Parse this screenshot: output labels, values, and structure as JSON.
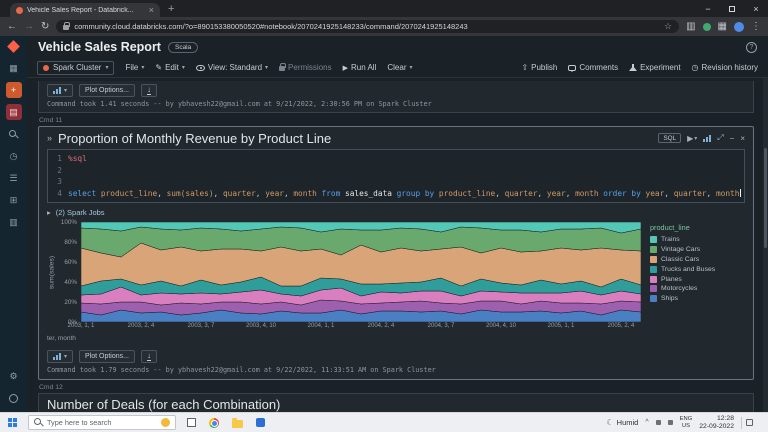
{
  "browser": {
    "tab_title": "Vehicle Sales Report - Databrick...",
    "url": "community.cloud.databricks.com/?o=890153380050520#notebook/2070241925148233/command/2070241925148243"
  },
  "header": {
    "title": "Vehicle Sales Report",
    "badge": "Scala"
  },
  "toolbar": {
    "cluster_label": "Spark Cluster",
    "file_label": "File",
    "edit_label": "Edit",
    "view_label": "View: Standard",
    "permissions_label": "Permissions",
    "run_all_label": "Run All",
    "clear_label": "Clear",
    "publish_label": "Publish",
    "comments_label": "Comments",
    "experiment_label": "Experiment",
    "revision_label": "Revision history"
  },
  "prev_cell": {
    "plot_options_label": "Plot Options...",
    "footer": "Command took 1.41 seconds -- by ybhavesh22@gmail.com at 9/21/2022, 2:30:56 PM on Spark Cluster"
  },
  "cmd11": {
    "label": "Cmd 11",
    "title": "Proportion of Monthly Revenue by Product Line",
    "badge": "SQL",
    "code": {
      "line_numbers": [
        "1",
        "2",
        "3",
        "4"
      ],
      "lines": [
        {
          "tokens": [
            {
              "text": "%sql",
              "type": "magic"
            }
          ]
        },
        {
          "tokens": []
        },
        {
          "tokens": []
        },
        {
          "tokens": [
            {
              "text": "select ",
              "type": "kw"
            },
            {
              "text": "product_line",
              "type": "col"
            },
            {
              "text": ", ",
              "type": "pun"
            },
            {
              "text": "sum(sales)",
              "type": "col"
            },
            {
              "text": ", ",
              "type": "pun"
            },
            {
              "text": "quarter",
              "type": "col"
            },
            {
              "text": ", ",
              "type": "pun"
            },
            {
              "text": "year",
              "type": "col"
            },
            {
              "text": ", ",
              "type": "pun"
            },
            {
              "text": "month",
              "type": "col"
            },
            {
              "text": " from ",
              "type": "kw"
            },
            {
              "text": "sales_data",
              "type": "tbl"
            },
            {
              "text": " group by ",
              "type": "kw"
            },
            {
              "text": "product_line",
              "type": "col"
            },
            {
              "text": ", ",
              "type": "pun"
            },
            {
              "text": "quarter",
              "type": "col"
            },
            {
              "text": ", ",
              "type": "pun"
            },
            {
              "text": "year",
              "type": "col"
            },
            {
              "text": ", ",
              "type": "pun"
            },
            {
              "text": "month",
              "type": "col"
            },
            {
              "text": " order by ",
              "type": "kw"
            },
            {
              "text": "year",
              "type": "col"
            },
            {
              "text": ", ",
              "type": "pun"
            },
            {
              "text": "quarter",
              "type": "col"
            },
            {
              "text": ", ",
              "type": "pun"
            },
            {
              "text": "month",
              "type": "col"
            }
          ]
        }
      ]
    },
    "spark_jobs_label": "(2) Spark Jobs",
    "plot_options_label": "Plot Options...",
    "footer": "Command took 1.79 seconds -- by ybhavesh22@gmail.com at 9/22/2022, 11:33:51 AM on Spark Cluster"
  },
  "cmd12": {
    "label": "Cmd 12",
    "title": "Number of Deals (for each Combination)"
  },
  "chart_data": {
    "type": "area",
    "stacked": "percent",
    "title": "Proportion of Monthly Revenue by Product Line",
    "ylabel": "sum(sales)",
    "xlabel": "ter, month",
    "legend_title": "product_line",
    "legend_position": "right",
    "grid": true,
    "ylim": [
      0,
      100
    ],
    "y_tick_labels": [
      "0%",
      "20%",
      "40%",
      "60%",
      "80%",
      "100%"
    ],
    "x_count": 29,
    "x_tick_indices": [
      0,
      3,
      6,
      9,
      12,
      15,
      18,
      21,
      24,
      27
    ],
    "x_tick_labels": [
      "2003, 1, 1",
      "2003, 2, 4",
      "2003, 3, 7",
      "2003, 4, 10",
      "2004, 1, 1",
      "2004, 2, 4",
      "2004, 3, 7",
      "2004, 4, 10",
      "2005, 1, 1",
      "2005, 2, 4"
    ],
    "series": [
      {
        "name": "Trains",
        "color": "#53c8b6",
        "values": [
          6,
          7,
          9,
          5,
          7,
          8,
          6,
          7,
          9,
          7,
          5,
          6,
          10,
          7,
          8,
          8,
          6,
          7,
          10,
          5,
          6,
          8,
          8,
          10,
          7,
          7,
          6,
          11,
          7
        ]
      },
      {
        "name": "Vintage Cars",
        "color": "#69a96e",
        "values": [
          20,
          24,
          26,
          16,
          21,
          17,
          23,
          20,
          18,
          22,
          20,
          23,
          17,
          26,
          15,
          22,
          20,
          22,
          17,
          20,
          25,
          18,
          22,
          19,
          19,
          21,
          20,
          17,
          22
        ]
      },
      {
        "name": "Classic Cars",
        "color": "#d8a478",
        "values": [
          38,
          28,
          22,
          42,
          31,
          39,
          29,
          36,
          33,
          26,
          39,
          35,
          29,
          24,
          39,
          32,
          35,
          31,
          29,
          39,
          26,
          35,
          33,
          29,
          36,
          31,
          39,
          29,
          34
        ]
      },
      {
        "name": "Trucks and Buses",
        "color": "#2f9e9b",
        "values": [
          9,
          13,
          8,
          10,
          12,
          8,
          13,
          9,
          10,
          13,
          8,
          10,
          12,
          9,
          12,
          8,
          10,
          9,
          13,
          10,
          12,
          9,
          8,
          13,
          9,
          10,
          8,
          12,
          9
        ]
      },
      {
        "name": "Planes",
        "color": "#d97fc0",
        "values": [
          8,
          10,
          15,
          7,
          12,
          9,
          11,
          8,
          10,
          14,
          8,
          9,
          10,
          13,
          8,
          11,
          9,
          10,
          12,
          8,
          10,
          9,
          11,
          8,
          10,
          12,
          9,
          10,
          8
        ]
      },
      {
        "name": "Motorcycles",
        "color": "#9d5fae",
        "values": [
          9,
          11,
          8,
          11,
          7,
          12,
          9,
          8,
          11,
          10,
          9,
          8,
          13,
          9,
          10,
          8,
          9,
          11,
          8,
          10,
          9,
          11,
          8,
          10,
          10,
          8,
          11,
          9,
          10
        ]
      },
      {
        "name": "Ships",
        "color": "#4b7fc4",
        "values": [
          10,
          7,
          12,
          9,
          10,
          7,
          9,
          12,
          9,
          8,
          11,
          9,
          9,
          12,
          8,
          11,
          11,
          10,
          11,
          8,
          12,
          10,
          10,
          11,
          9,
          11,
          7,
          12,
          10
        ]
      }
    ]
  },
  "taskbar": {
    "search_placeholder": "Type here to search",
    "weather_label": "Humid",
    "language_line1": "ENG",
    "language_line2": "US",
    "time": "12:28",
    "date": "22-09-2022"
  },
  "icons": {
    "close": "×",
    "minimize": "−",
    "plus": "+",
    "back": "←",
    "forward": "→",
    "reload": "↻",
    "star": "☆",
    "menu_dots": "⋮",
    "panel": "▥",
    "grid": "▦",
    "doc": "▤",
    "list": "☰",
    "gear": "⚙",
    "clock": "◷",
    "question": "?",
    "collapse": "»",
    "caret_down": "▾",
    "play": "▶",
    "expand": "⤢",
    "pencil": "✎",
    "upload": "⇧",
    "spark_arrow": "▸",
    "moon": "☾",
    "tray_expand": "^",
    "download": "↓",
    "compute": "⊞"
  }
}
